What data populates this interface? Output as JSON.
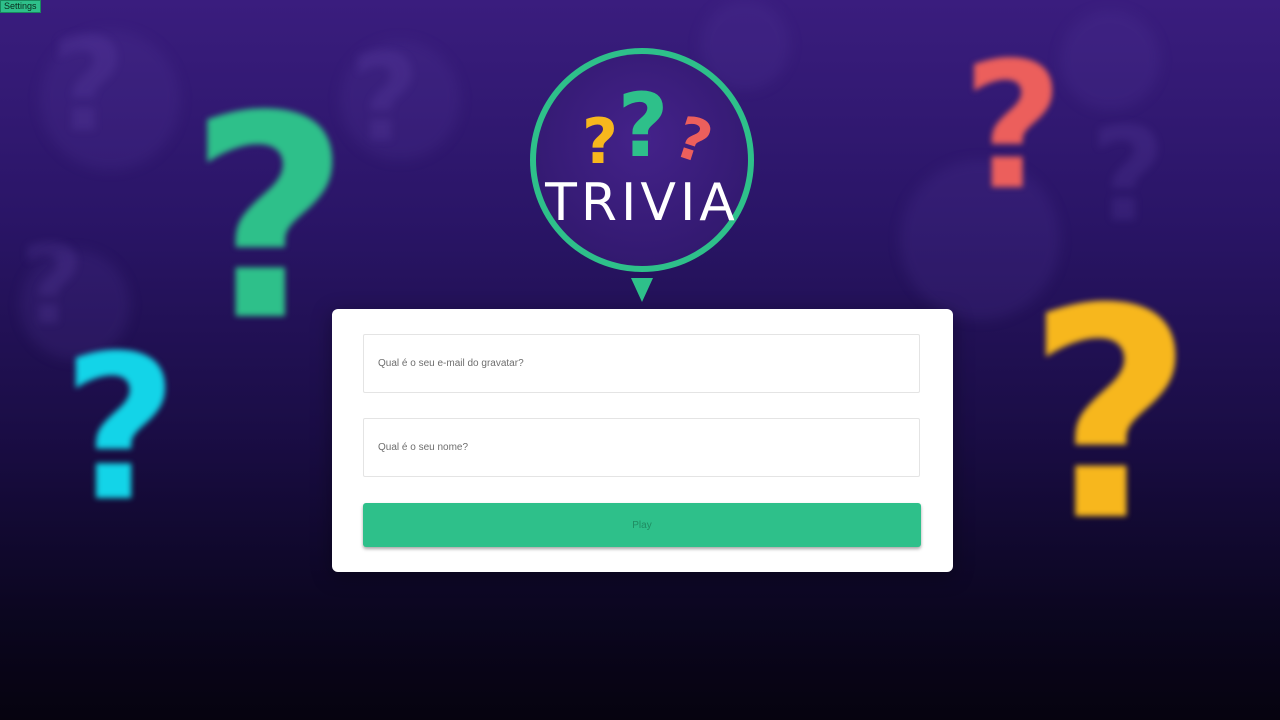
{
  "settings": {
    "label": "Settings"
  },
  "logo": {
    "title": "TRIVIA",
    "mark": "?"
  },
  "form": {
    "email_placeholder": "Qual é o seu e-mail do gravatar?",
    "name_placeholder": "Qual é o seu nome?",
    "play_label": "Play"
  },
  "background": {
    "mark": "?",
    "colors": {
      "green": "#2ec08a",
      "cyan": "#13d4e8",
      "coral": "#ec5f5c",
      "yellow": "#f7b71d",
      "purple_dark": "#3a1d7e"
    }
  },
  "icons": {
    "logo_question_marks": [
      "yellow",
      "green",
      "coral"
    ],
    "background_question_marks": [
      "green",
      "cyan",
      "coral",
      "yellow"
    ]
  }
}
